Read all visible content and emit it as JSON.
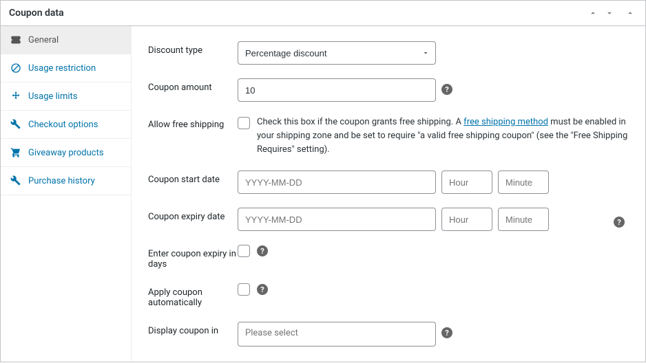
{
  "panel": {
    "title": "Coupon data"
  },
  "sidebar": {
    "items": [
      {
        "label": "General"
      },
      {
        "label": "Usage restriction"
      },
      {
        "label": "Usage limits"
      },
      {
        "label": "Checkout options"
      },
      {
        "label": "Giveaway products"
      },
      {
        "label": "Purchase history"
      }
    ]
  },
  "fields": {
    "discount_type": {
      "label": "Discount type",
      "value": "Percentage discount"
    },
    "coupon_amount": {
      "label": "Coupon amount",
      "value": "10"
    },
    "free_shipping": {
      "label": "Allow free shipping",
      "desc_before": "Check this box if the coupon grants free shipping. A ",
      "link_text": "free shipping method",
      "desc_after": " must be enabled in your shipping zone and be set to require \"a valid free shipping coupon\" (see the \"Free Shipping Requires\" setting)."
    },
    "start_date": {
      "label": "Coupon start date",
      "placeholder_date": "YYYY-MM-DD",
      "placeholder_hour": "Hour",
      "placeholder_minute": "Minute"
    },
    "expiry_date": {
      "label": "Coupon expiry date",
      "placeholder_date": "YYYY-MM-DD",
      "placeholder_hour": "Hour",
      "placeholder_minute": "Minute"
    },
    "expiry_days": {
      "label": "Enter coupon expiry in days"
    },
    "auto_apply": {
      "label": "Apply coupon automatically"
    },
    "display_in": {
      "label": "Display coupon in",
      "placeholder": "Please select"
    }
  }
}
